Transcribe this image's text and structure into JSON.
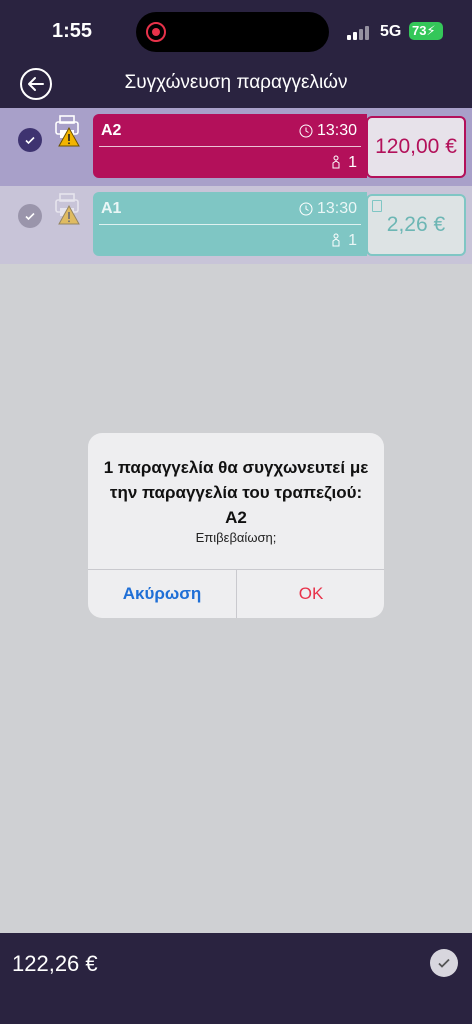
{
  "status_bar": {
    "time": "1:55",
    "network": "5G",
    "battery": "73"
  },
  "header": {
    "title": "Συγχώνευση παραγγελιών"
  },
  "orders": [
    {
      "name": "A2",
      "time": "13:30",
      "guests": "1",
      "price": "120,00 €",
      "color": "#b3105a",
      "selected": true
    },
    {
      "name": "A1",
      "time": "13:30",
      "guests": "1",
      "price": "2,26 €",
      "color": "#7fc6c4",
      "selected": false
    }
  ],
  "dialog": {
    "message": "1 παραγγελία θα συγχωνευτεί με την παραγγελία του τραπεζιού: A2",
    "subtitle": "Επιβεβαίωση;",
    "cancel_label": "Ακύρωση",
    "ok_label": "OK"
  },
  "footer": {
    "total": "122,26 €"
  }
}
